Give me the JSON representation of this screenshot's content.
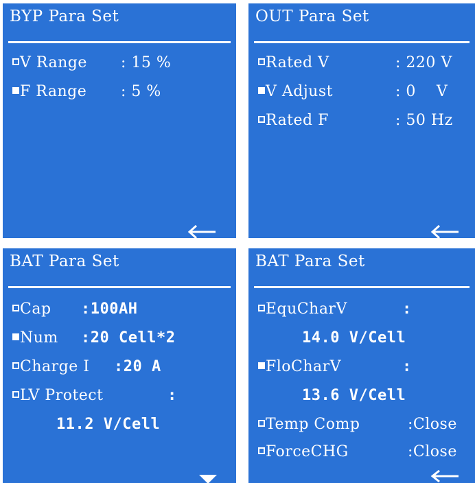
{
  "panels": {
    "byp": {
      "title": "BYP Para Set",
      "items": [
        {
          "label": "V Range",
          "value": ": 15 %",
          "selected": false
        },
        {
          "label": "F Range",
          "value": ": 5 %",
          "selected": true
        }
      ],
      "nav_icon": "back-arrow-icon"
    },
    "out": {
      "title": "OUT Para Set",
      "items": [
        {
          "label": "Rated V",
          "value": ": 220 V",
          "selected": false
        },
        {
          "label": "V Adjust",
          "value": ": 0    V",
          "selected": true
        },
        {
          "label": "Rated F",
          "value": ": 50 Hz",
          "selected": false
        }
      ],
      "nav_icon": "back-arrow-icon"
    },
    "bat1": {
      "title": "BAT Para Set",
      "items": [
        {
          "label": "Cap",
          "value": ":100AH",
          "selected": false
        },
        {
          "label": "Num",
          "value": ":20 Cell*2",
          "selected": true
        },
        {
          "label": "Charge I",
          "value": ":20 A",
          "selected": false
        },
        {
          "label": "LV Protect",
          "value": ":",
          "selected": false,
          "subvalue": "11.2 V/Cell"
        }
      ],
      "nav_icon": "down-triangle-icon"
    },
    "bat2": {
      "title": "BAT Para Set",
      "items": [
        {
          "label": "EquCharV",
          "value": ":",
          "selected": false,
          "subvalue": "14.0 V/Cell"
        },
        {
          "label": "FloCharV",
          "value": ":",
          "selected": true,
          "subvalue": "13.6 V/Cell"
        },
        {
          "label": "Temp Comp",
          "value": ":Close",
          "selected": false
        },
        {
          "label": "ForceCHG",
          "value": ":Close",
          "selected": false
        }
      ],
      "nav_icon": "back-arrow-icon"
    }
  },
  "colors": {
    "panel_bg": "#2a72d6",
    "text": "#ffffff",
    "page_bg": "#ffffff"
  }
}
